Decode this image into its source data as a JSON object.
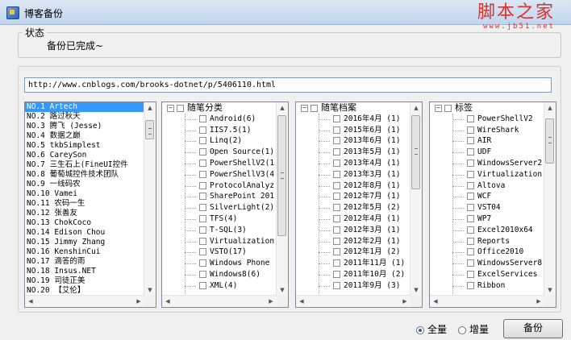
{
  "window": {
    "title": "博客备份"
  },
  "watermark": {
    "logo": "脚本之家",
    "url": "www.jb51.net"
  },
  "status_group": {
    "title": "状态",
    "text": "备份已完成~"
  },
  "url_input": {
    "value": "http://www.cnblogs.com/brooks-dotnet/p/5406110.html"
  },
  "blog_list": {
    "items": [
      "NO.1 Artech",
      "NO.2 路过秋天",
      "NO.3 腾飞 (Jesse)",
      "NO.4 数据之巅",
      "NO.5 tkbSimplest",
      "NO.6 CareySon",
      "NO.7 三生石上(FineUI控件",
      "NO.8 葡萄城控件技术团队",
      "NO.9 一线码农",
      "NO.10 Vamei",
      "NO.11 农码一生",
      "NO.12 张善友",
      "NO.13 ChokCoco",
      "NO.14 Edison Chou",
      "NO.15 Jimmy Zhang",
      "NO.16 KenshinCui",
      "NO.17 滴答的雨",
      "NO.18 Insus.NET",
      "NO.19 司徒正美",
      "NO.20 【艾伦】"
    ],
    "selected": "NO.1 Artech"
  },
  "categories_tree": {
    "root": "随笔分类",
    "items": [
      "Android(6)",
      "IIS7.5(1)",
      "Linq(2)",
      "Open Source(1)",
      "PowerShellV2(1)",
      "PowerShellV3(4",
      "ProtocolAnalyz",
      "SharePoint 201",
      "SilverLight(2)",
      "TFS(4)",
      "T-SQL(3)",
      "Virtualization",
      "VSTO(17)",
      "Windows Phone",
      "Windows8(6)",
      "XML(4)"
    ]
  },
  "archive_tree": {
    "root": "随笔档案",
    "items": [
      "2016年4月 (1)",
      "2015年6月 (1)",
      "2013年6月 (1)",
      "2013年5月 (1)",
      "2013年4月 (1)",
      "2013年3月 (1)",
      "2012年8月 (1)",
      "2012年7月 (1)",
      "2012年5月 (2)",
      "2012年4月 (1)",
      "2012年3月 (1)",
      "2012年2月 (1)",
      "2012年1月 (2)",
      "2011年11月 (1)",
      "2011年10月 (2)",
      "2011年9月 (3)"
    ]
  },
  "tags_tree": {
    "root": "标签",
    "items": [
      "PowerShellV2",
      "WireShark",
      "AIR",
      "UDF",
      "WindowsServer2",
      "Virtualization",
      "Altova",
      "WCF",
      "VST04",
      "WP7",
      "Excel2010x64",
      "Reports",
      "Office2010",
      "WindowsServer8",
      "ExcelServices",
      "Ribbon"
    ]
  },
  "options": {
    "full_label": "全量",
    "incremental_label": "增量",
    "selected": "full"
  },
  "backup_button": {
    "label": "备份"
  }
}
